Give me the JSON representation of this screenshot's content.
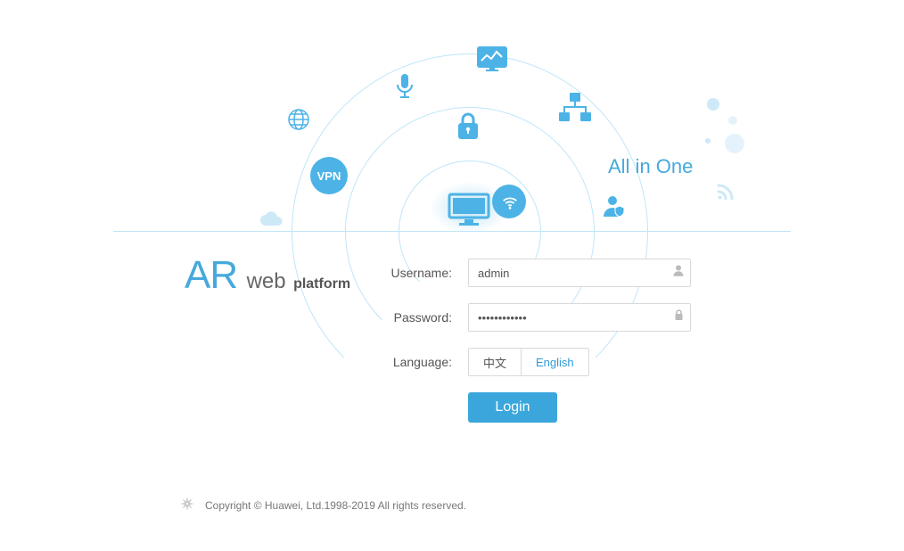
{
  "hero": {
    "slogan": "All in One",
    "vpn_label": "VPN",
    "icons": {
      "monitor": "monitor-icon",
      "wifi": "wifi-icon",
      "lock": "lock-icon",
      "mic": "microphone-icon",
      "dashboard": "dashboard-icon",
      "network": "network-icon",
      "vpn": "vpn-icon",
      "globe": "globe-icon",
      "cloud": "cloud-icon",
      "user_shield": "user-shield-icon",
      "rss": "rss-icon"
    }
  },
  "brand": {
    "ar": "AR",
    "web": "web",
    "platform": "platform"
  },
  "form": {
    "username_label": "Username:",
    "username_value": "admin",
    "username_placeholder": "",
    "password_label": "Password:",
    "password_value": "••••••••••••",
    "password_placeholder": "",
    "language_label": "Language:",
    "lang_zh": "中文",
    "lang_en": "English",
    "lang_selected": "English",
    "login_label": "Login"
  },
  "footer": {
    "copyright": "Copyright © Huawei, Ltd.1998-2019 All rights reserved."
  },
  "colors": {
    "accent": "#3aa6dc",
    "pale": "#bfe6f9"
  }
}
